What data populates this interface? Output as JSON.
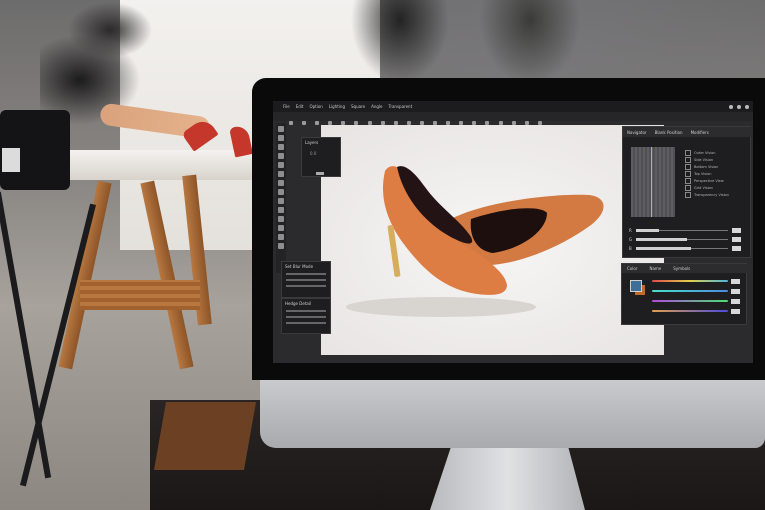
{
  "menu": {
    "items": [
      "File",
      "Edit",
      "Option",
      "Lighting",
      "Square",
      "Angle",
      "Transparent"
    ]
  },
  "panels": {
    "layers": {
      "title": "Layers",
      "value": "0.0"
    },
    "panel_a": {
      "title": "Set Blur Mode"
    },
    "panel_b": {
      "title": "Hedge Detail"
    }
  },
  "navigator": {
    "tabs": [
      "Navigator",
      "Blank Position",
      "Modifiers"
    ],
    "options": [
      "Outer Vision",
      "Side Vision",
      "Bottom Vision",
      "Top Vision",
      "Perspective View",
      "Grid Vision",
      "Transparency Vision"
    ],
    "slider_labels": [
      "R",
      "G",
      "B"
    ],
    "slider_levels": [
      0.25,
      0.55,
      0.6,
      0.8
    ]
  },
  "color_panel": {
    "tabs": [
      "Color",
      "Name",
      "Symbols"
    ],
    "foreground": "#3d6f98",
    "background": "#c06a2e",
    "tracks": [
      {
        "colors": "#e24a4a,#e0d24a,#4ab6e0",
        "level": 0.7
      },
      {
        "colors": "#4ae0c6,#4a8be0",
        "level": 0.85
      },
      {
        "colors": "#b04ae0,#4ae06f",
        "level": 0.55
      },
      {
        "colors": "#e0a04a,#4a4ae0",
        "level": 0.8
      }
    ]
  },
  "icons": {
    "window_controls": [
      "minimize-icon",
      "maximize-icon",
      "close-icon"
    ]
  }
}
